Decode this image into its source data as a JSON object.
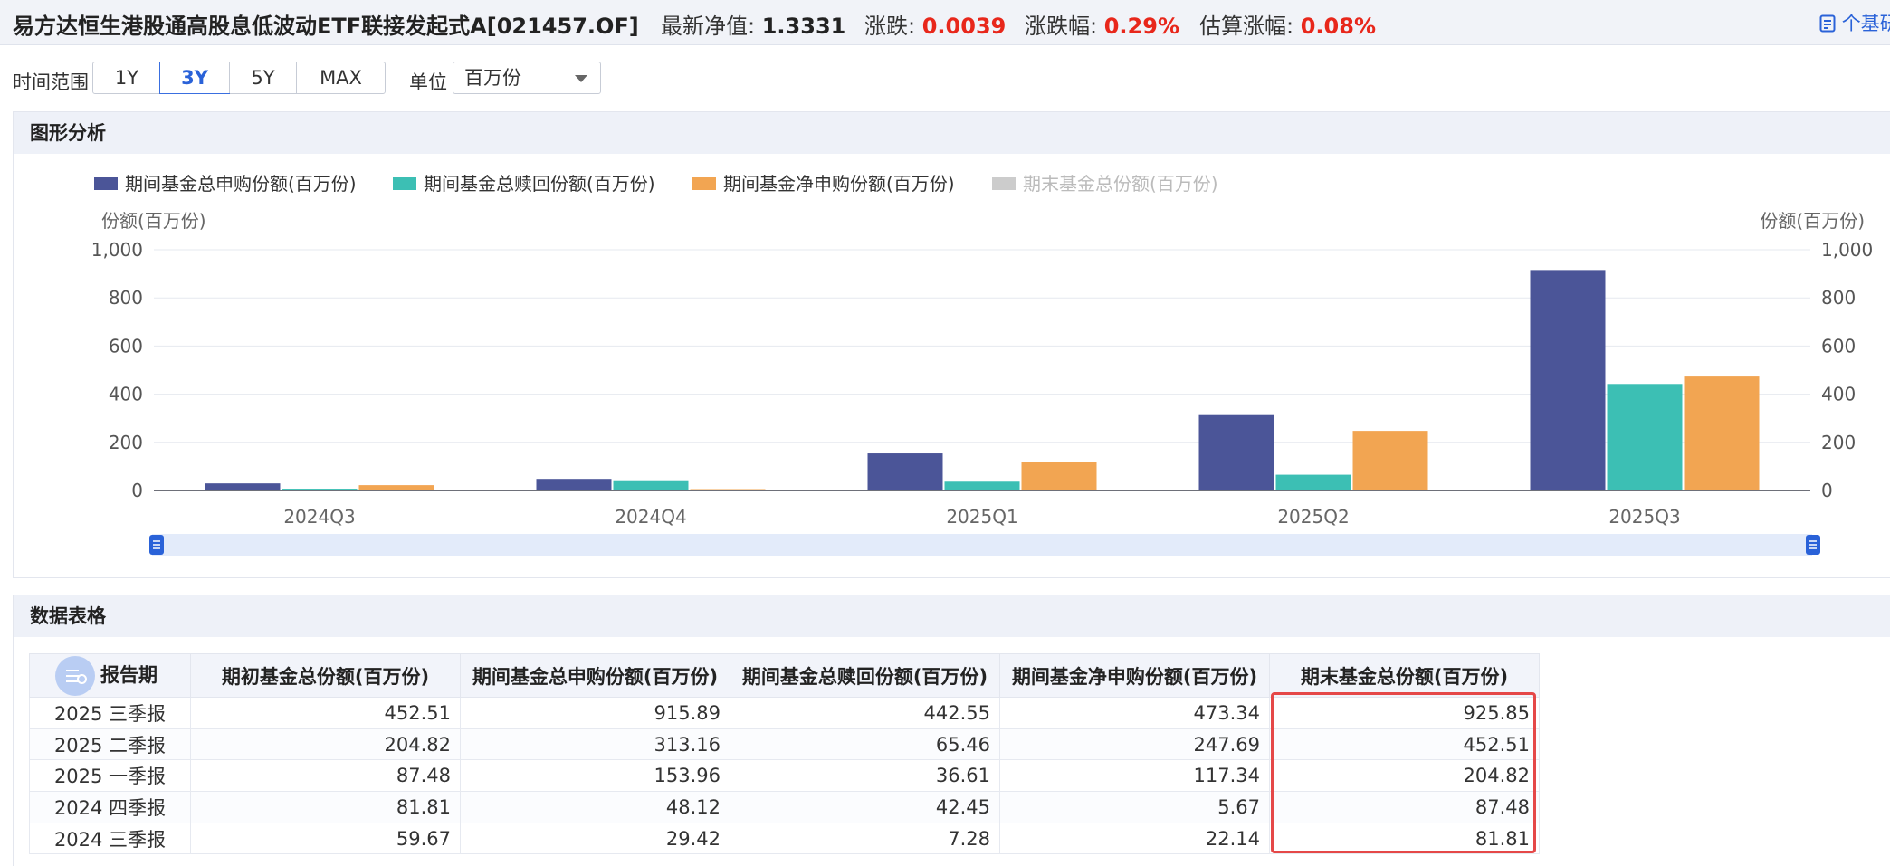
{
  "header": {
    "fund_title": "易方达恒生港股通高股息低波动ETF联接发起式A[021457.OF]",
    "nav_label": "最新净值:",
    "nav_value": "1.3331",
    "change_label": "涨跌:",
    "change_value": "0.0039",
    "pct_label": "涨跌幅:",
    "pct_value": "0.29%",
    "est_label": "估算涨幅:",
    "est_value": "0.08%",
    "report_link": "个基研"
  },
  "controls": {
    "range_label": "时间范围",
    "ranges": [
      "1Y",
      "3Y",
      "5Y",
      "MAX"
    ],
    "active_range": "3Y",
    "unit_label": "单位",
    "unit_value": "百万份"
  },
  "chart_panel": {
    "title": "图形分析"
  },
  "table_panel": {
    "title": "数据表格"
  },
  "colors": {
    "subscribe": "#4b5598",
    "redeem": "#3cbfb4",
    "net": "#f2a552",
    "end": "#cccccc",
    "accent": "#2a62d8",
    "up": "#e8271b"
  },
  "chart_data": {
    "type": "bar",
    "categories": [
      "2024Q3",
      "2024Q4",
      "2025Q1",
      "2025Q2",
      "2025Q3"
    ],
    "series": [
      {
        "name": "期间基金总申购份额(百万份)",
        "values": [
          29.42,
          48.12,
          153.96,
          313.16,
          915.89
        ],
        "color": "#4b5598",
        "visible": true
      },
      {
        "name": "期间基金总赎回份额(百万份)",
        "values": [
          7.28,
          42.45,
          36.61,
          65.46,
          442.55
        ],
        "color": "#3cbfb4",
        "visible": true
      },
      {
        "name": "期间基金净申购份额(百万份)",
        "values": [
          22.14,
          5.67,
          117.34,
          247.69,
          473.34
        ],
        "color": "#f2a552",
        "visible": true
      },
      {
        "name": "期末基金总份额(百万份)",
        "values": [
          81.81,
          87.48,
          204.82,
          452.51,
          925.85
        ],
        "color": "#cccccc",
        "visible": false
      }
    ],
    "ylabel_left": "份额(百万份)",
    "ylabel_right": "份额(百万份)",
    "ylim": [
      0,
      1000
    ],
    "yticks": [
      "0",
      "200",
      "400",
      "600",
      "800",
      "1,000"
    ],
    "grid": true,
    "legend_position": "top-left"
  },
  "table": {
    "headers": [
      "报告期",
      "期初基金总份额(百万份)",
      "期间基金总申购份额(百万份)",
      "期间基金总赎回份额(百万份)",
      "期间基金净申购份额(百万份)",
      "期末基金总份额(百万份)"
    ],
    "rows": [
      [
        "2025 三季报",
        "452.51",
        "915.89",
        "442.55",
        "473.34",
        "925.85"
      ],
      [
        "2025 二季报",
        "204.82",
        "313.16",
        "65.46",
        "247.69",
        "452.51"
      ],
      [
        "2025 一季报",
        "87.48",
        "153.96",
        "36.61",
        "117.34",
        "204.82"
      ],
      [
        "2024 四季报",
        "81.81",
        "48.12",
        "42.45",
        "5.67",
        "87.48"
      ],
      [
        "2024 三季报",
        "59.67",
        "29.42",
        "7.28",
        "22.14",
        "81.81"
      ]
    ]
  }
}
